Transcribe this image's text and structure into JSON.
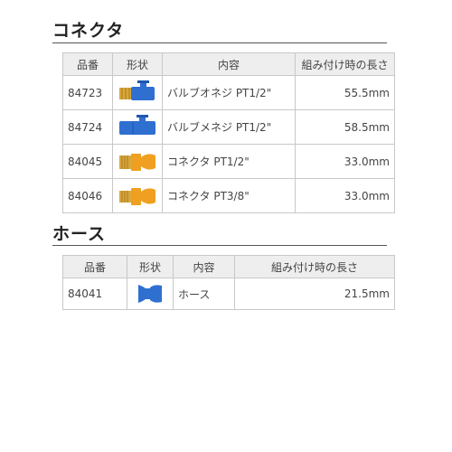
{
  "connector_section": {
    "title": "コネクタ",
    "headers": [
      "品番",
      "形状",
      "内容",
      "組み付け時の長さ"
    ],
    "rows": [
      {
        "code": "84723",
        "shape_icon": "blue-ball-valve-male-thread-icon",
        "desc": "バルブオネジ PT1/2\"",
        "length": "55.5mm"
      },
      {
        "code": "84724",
        "shape_icon": "blue-ball-valve-female-thread-icon",
        "desc": "バルブメネジ PT1/2\"",
        "length": "58.5mm"
      },
      {
        "code": "84045",
        "shape_icon": "orange-connector-pt12-icon",
        "desc": "コネクタ PT1/2\"",
        "length": "33.0mm"
      },
      {
        "code": "84046",
        "shape_icon": "orange-connector-pt38-icon",
        "desc": "コネクタ PT3/8\"",
        "length": "33.0mm"
      }
    ]
  },
  "hose_section": {
    "title": "ホース",
    "headers": [
      "品番",
      "形状",
      "内容",
      "組み付け時の長さ"
    ],
    "rows": [
      {
        "code": "84041",
        "shape_icon": "blue-hose-segment-icon",
        "desc": "ホース",
        "length": "21.5mm"
      }
    ]
  },
  "colors": {
    "header_bg": "#eeeeee",
    "border": "#c8c8c8",
    "blue": "#2f6fd0",
    "orange": "#f0a020",
    "brass": "#d9a83c"
  }
}
